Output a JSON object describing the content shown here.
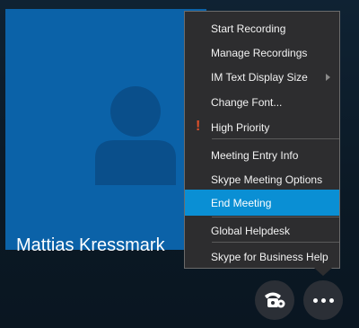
{
  "participant": {
    "name": "Mattias Kressmark"
  },
  "menu": {
    "items": [
      {
        "label": "Start Recording"
      },
      {
        "label": "Manage Recordings"
      },
      {
        "label": "IM Text Display Size"
      },
      {
        "label": "Change Font..."
      },
      {
        "label": "High Priority"
      },
      {
        "label": "Meeting Entry Info"
      },
      {
        "label": "Skype Meeting Options"
      },
      {
        "label": "End Meeting"
      },
      {
        "label": "Global Helpdesk"
      },
      {
        "label": "Skype for Business Help"
      }
    ],
    "highlighted": "End Meeting"
  },
  "icons": {
    "avatar": "person-silhouette-icon",
    "priority": "exclamation-icon",
    "call_controls": "phone-settings-icon",
    "more": "more-options-icon"
  },
  "colors": {
    "tile": "#0b62a8",
    "menu_bg": "#2d2d2f",
    "highlight": "#0a8fd4",
    "priority": "#e0502a"
  }
}
